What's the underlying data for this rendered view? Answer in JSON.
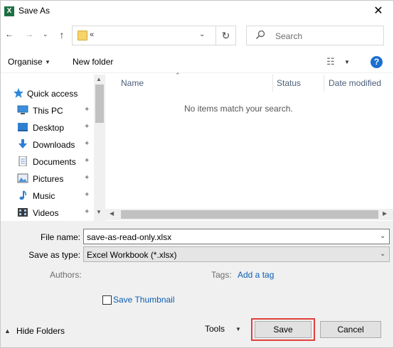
{
  "window": {
    "title": "Save As",
    "app_icon_letter": "X",
    "close_glyph": "✕"
  },
  "nav": {
    "back_glyph": "←",
    "forward_glyph": "→",
    "recent_glyph": "⌄",
    "up_glyph": "↑",
    "address_text": "«",
    "address_chevron": "⌄",
    "refresh_glyph": "↻",
    "search_placeholder": "Search"
  },
  "toolbar": {
    "organise_label": "Organise",
    "newfolder_label": "New folder",
    "view_glyph": "☷",
    "help_glyph": "?",
    "dropdown_glyph": "▼"
  },
  "sidebar": {
    "items": [
      {
        "label": "Quick access",
        "icon": "star-icon"
      },
      {
        "label": "This PC",
        "icon": "computer-icon"
      },
      {
        "label": "Desktop",
        "icon": "desktop-icon"
      },
      {
        "label": "Downloads",
        "icon": "download-icon"
      },
      {
        "label": "Documents",
        "icon": "documents-icon"
      },
      {
        "label": "Pictures",
        "icon": "pictures-icon"
      },
      {
        "label": "Music",
        "icon": "music-icon"
      },
      {
        "label": "Videos",
        "icon": "videos-icon"
      }
    ],
    "pin_glyph": "📌"
  },
  "filelist": {
    "columns": [
      "Name",
      "Status",
      "Date modified"
    ],
    "empty_message": "No items match your search."
  },
  "form": {
    "filename_label": "File name:",
    "filename_value": "save-as-read-only.xlsx",
    "savetype_label": "Save as type:",
    "savetype_value": "Excel Workbook (*.xlsx)",
    "authors_label": "Authors:",
    "tags_label": "Tags:",
    "tags_link": "Add a tag",
    "thumbnail_label": "Save Thumbnail"
  },
  "footer": {
    "hide_folders_label": "Hide Folders",
    "tools_label": "Tools",
    "save_label": "Save",
    "cancel_label": "Cancel"
  },
  "colors": {
    "accent_link": "#0b5fb3",
    "highlight_box": "#e0403a",
    "excel_green": "#1d6f42"
  }
}
